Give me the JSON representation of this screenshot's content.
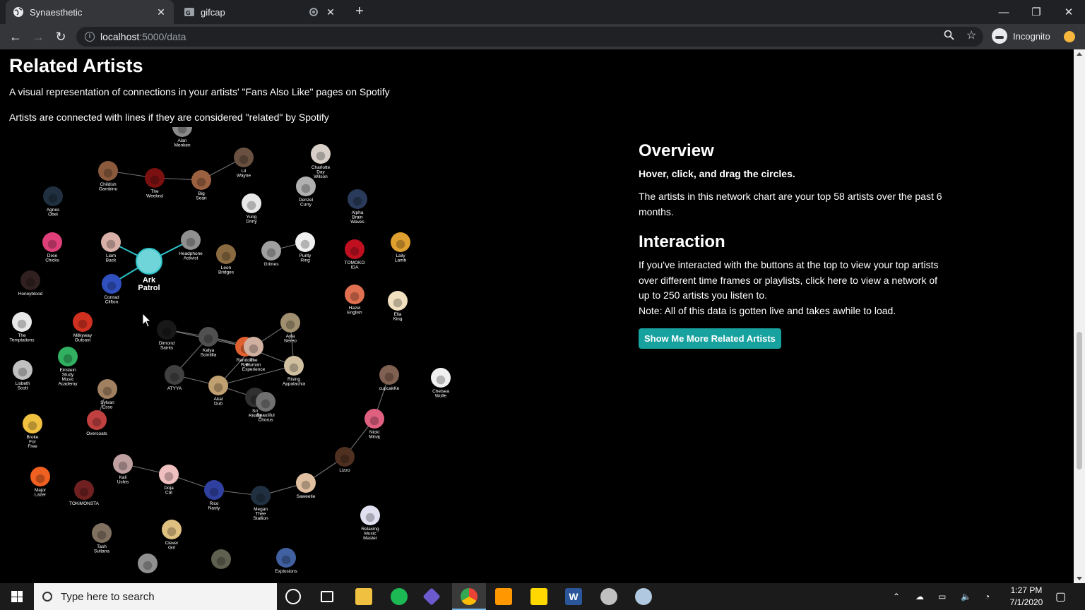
{
  "browser": {
    "tabs": [
      {
        "title": "Synaesthetic",
        "active": true
      },
      {
        "title": "gifcap",
        "active": false
      }
    ],
    "url_host": "localhost",
    "url_path": ":5000/data",
    "profile_label": "Incognito"
  },
  "page": {
    "heading": "Related Artists",
    "intro_1": "A visual representation of connections in your artists' \"Fans Also Like\" pages on Spotify",
    "intro_2": "Artists are connected with lines if they are considered \"related\" by Spotify"
  },
  "sidebar": {
    "overview_title": "Overview",
    "overview_hint": "Hover, click, and drag the circles.",
    "overview_text": "The artists in this network chart are your top 58 artists over the past 6 months.",
    "interaction_title": "Interaction",
    "interaction_text": "If you've interacted with the buttons at the top to view your top artists over different time frames or playlists, click here to view a network of up to 250 artists you listen to.",
    "note_text": "Note: All of this data is gotten live and takes awhile to load.",
    "button_label": "Show Me More Related Artists"
  },
  "network": {
    "highlighted": "Ark Patrol",
    "nodes": [
      {
        "id": "alan",
        "label": "Alan Menken",
        "color": "#8a8a8a"
      },
      {
        "id": "charlotte",
        "label": "Charlotte Day Wilson",
        "color": "#d8d0c8"
      },
      {
        "id": "childish",
        "label": "Childish Gambino",
        "color": "#8b5a3c"
      },
      {
        "id": "weeknd",
        "label": "The Weeknd",
        "color": "#7a1010"
      },
      {
        "id": "bigsean",
        "label": "Big Sean",
        "color": "#9a6040"
      },
      {
        "id": "lilwayne",
        "label": "Lil Wayne",
        "color": "#6a5040"
      },
      {
        "id": "agnes",
        "label": "Agnes Obel",
        "color": "#203040"
      },
      {
        "id": "yungdnny",
        "label": "Yung Dnny",
        "color": "#e8e8e8"
      },
      {
        "id": "denzel",
        "label": "Denzel Curry",
        "color": "#b0b0b0"
      },
      {
        "id": "alpha",
        "label": "Alpha Brain Waves",
        "color": "#2a3a5a"
      },
      {
        "id": "dixie",
        "label": "Dixie Chicks",
        "color": "#e0407a"
      },
      {
        "id": "liam",
        "label": "Liam Back",
        "color": "#d8b0a8"
      },
      {
        "id": "ark",
        "label": "Ark Patrol",
        "color": "#6fd5d8"
      },
      {
        "id": "headphone",
        "label": "Headphone Activist",
        "color": "#909090"
      },
      {
        "id": "leon",
        "label": "Leon Bridges",
        "color": "#8a6a40"
      },
      {
        "id": "grimes",
        "label": "Grimes",
        "color": "#a0a0a0"
      },
      {
        "id": "purity",
        "label": "Purity Ring",
        "color": "#f0f0f0"
      },
      {
        "id": "tomoko",
        "label": "TOMOKO IDA",
        "color": "#c01020"
      },
      {
        "id": "laily",
        "label": "Laily Lamb",
        "color": "#e0a030"
      },
      {
        "id": "honeyblood",
        "label": "Honeyblood",
        "color": "#302020"
      },
      {
        "id": "conrad",
        "label": "Conrad Clifton",
        "color": "#3050c0"
      },
      {
        "id": "hazel",
        "label": "Hazel English",
        "color": "#e07050"
      },
      {
        "id": "ella",
        "label": "Ella King",
        "color": "#f0e0c0"
      },
      {
        "id": "temptations",
        "label": "The Temptations",
        "color": "#e8e8e8"
      },
      {
        "id": "milkyway",
        "label": "Milkyway Outcast",
        "color": "#d03020"
      },
      {
        "id": "dimond",
        "label": "Dimond Saints",
        "color": "#181818"
      },
      {
        "id": "kalya",
        "label": "Kalya Scintilla",
        "color": "#505050"
      },
      {
        "id": "random",
        "label": "Random Rab",
        "color": "#e06030"
      },
      {
        "id": "human",
        "label": "The Human Experience",
        "color": "#d0b0a0"
      },
      {
        "id": "ayla",
        "label": "Ayla Nereo",
        "color": "#a09070"
      },
      {
        "id": "einstein",
        "label": "Einstein Study Music Academy",
        "color": "#30b060"
      },
      {
        "id": "lisbeth",
        "label": "Lisbeth Scott",
        "color": "#c0c0c0"
      },
      {
        "id": "atyya",
        "label": "ATYYA",
        "color": "#404040"
      },
      {
        "id": "akal",
        "label": "Akal Dub",
        "color": "#c0a070"
      },
      {
        "id": "rising",
        "label": "Rising Appalachia",
        "color": "#d0c0a0"
      },
      {
        "id": "cupcakke",
        "label": "cupcakKe",
        "color": "#806050"
      },
      {
        "id": "chelsea",
        "label": "Chelsea Wolfe",
        "color": "#f0f0f0"
      },
      {
        "id": "sylvan",
        "label": "Sylvan Esso",
        "color": "#a08060"
      },
      {
        "id": "sri",
        "label": "Sri Rising",
        "color": "#303030"
      },
      {
        "id": "beautiful",
        "label": "Beautiful Chorus",
        "color": "#707070"
      },
      {
        "id": "broke",
        "label": "Broke For Free",
        "color": "#f0c040"
      },
      {
        "id": "overcoats",
        "label": "Overcoats",
        "color": "#c04040"
      },
      {
        "id": "nicki",
        "label": "Nicki Minaj",
        "color": "#e06080"
      },
      {
        "id": "lizzo",
        "label": "Lizzo",
        "color": "#503020"
      },
      {
        "id": "kali",
        "label": "Kali Uchis",
        "color": "#c0a0a0"
      },
      {
        "id": "doja",
        "label": "Doja Cat",
        "color": "#f0c0c0"
      },
      {
        "id": "major",
        "label": "Major Lazer",
        "color": "#f06020"
      },
      {
        "id": "tokimonsta",
        "label": "TOKiMONSTA",
        "color": "#702020"
      },
      {
        "id": "rico",
        "label": "Rico Nasty",
        "color": "#3040a0"
      },
      {
        "id": "megan",
        "label": "Megan Thee Stallion",
        "color": "#203040"
      },
      {
        "id": "saweetie",
        "label": "Saweetie",
        "color": "#e0c0a0"
      },
      {
        "id": "relaxing",
        "label": "Relaxing Music Master",
        "color": "#e0e0f0"
      },
      {
        "id": "tash",
        "label": "Tash Sultana",
        "color": "#807060"
      },
      {
        "id": "clever",
        "label": "Clever Girl",
        "color": "#e0c080"
      },
      {
        "id": "bottom1",
        "label": "",
        "color": "#909090"
      },
      {
        "id": "bottom2",
        "label": "",
        "color": "#606050"
      },
      {
        "id": "explosions",
        "label": "Explosions",
        "color": "#4060a0"
      }
    ],
    "links": [
      [
        "childish",
        "weeknd"
      ],
      [
        "weeknd",
        "bigsean"
      ],
      [
        "bigsean",
        "lilwayne"
      ],
      [
        "liam",
        "ark"
      ],
      [
        "ark",
        "headphone"
      ],
      [
        "ark",
        "conrad"
      ],
      [
        "grimes",
        "purity"
      ],
      [
        "dimond",
        "kalya"
      ],
      [
        "kalya",
        "random"
      ],
      [
        "random",
        "human"
      ],
      [
        "human",
        "ayla"
      ],
      [
        "ayla",
        "rising"
      ],
      [
        "kalya",
        "human"
      ],
      [
        "atyya",
        "kalya"
      ],
      [
        "atyya",
        "akal"
      ],
      [
        "akal",
        "human"
      ],
      [
        "akal",
        "rising"
      ],
      [
        "akal",
        "sri"
      ],
      [
        "sri",
        "beautiful"
      ],
      [
        "random",
        "rising"
      ],
      [
        "dimond",
        "random"
      ],
      [
        "sylvan",
        "overcoats"
      ],
      [
        "cupcakke",
        "nicki"
      ],
      [
        "nicki",
        "lizzo"
      ],
      [
        "lizzo",
        "saweetie"
      ],
      [
        "saweetie",
        "megan"
      ],
      [
        "megan",
        "rico"
      ],
      [
        "rico",
        "doja"
      ],
      [
        "doja",
        "kali"
      ]
    ]
  }
}
